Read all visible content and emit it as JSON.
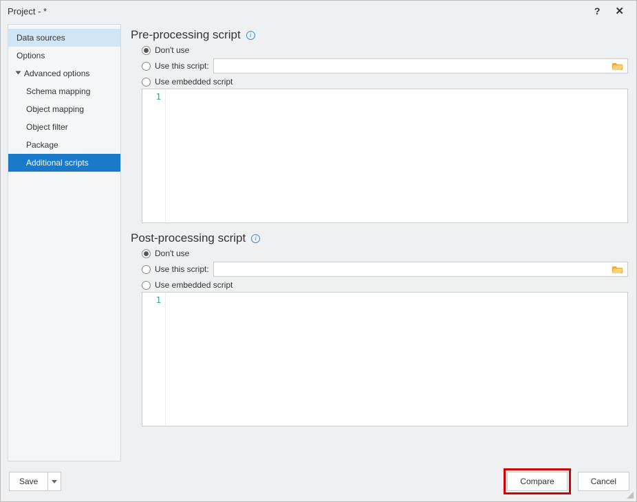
{
  "window": {
    "title": "Project - *"
  },
  "sidebar": {
    "items": [
      {
        "label": "Data sources"
      },
      {
        "label": "Options"
      },
      {
        "label": "Advanced options"
      },
      {
        "label": "Schema mapping"
      },
      {
        "label": "Object mapping"
      },
      {
        "label": "Object filter"
      },
      {
        "label": "Package"
      },
      {
        "label": "Additional scripts"
      }
    ]
  },
  "pre": {
    "title": "Pre-processing script",
    "opt_dont_use": "Don't use",
    "opt_use_script": "Use this script:",
    "opt_embedded": "Use embedded script",
    "script_path": "",
    "gutter": "1"
  },
  "post": {
    "title": "Post-processing script",
    "opt_dont_use": "Don't use",
    "opt_use_script": "Use this script:",
    "opt_embedded": "Use embedded script",
    "script_path": "",
    "gutter": "1"
  },
  "footer": {
    "save": "Save",
    "compare": "Compare",
    "cancel": "Cancel"
  }
}
